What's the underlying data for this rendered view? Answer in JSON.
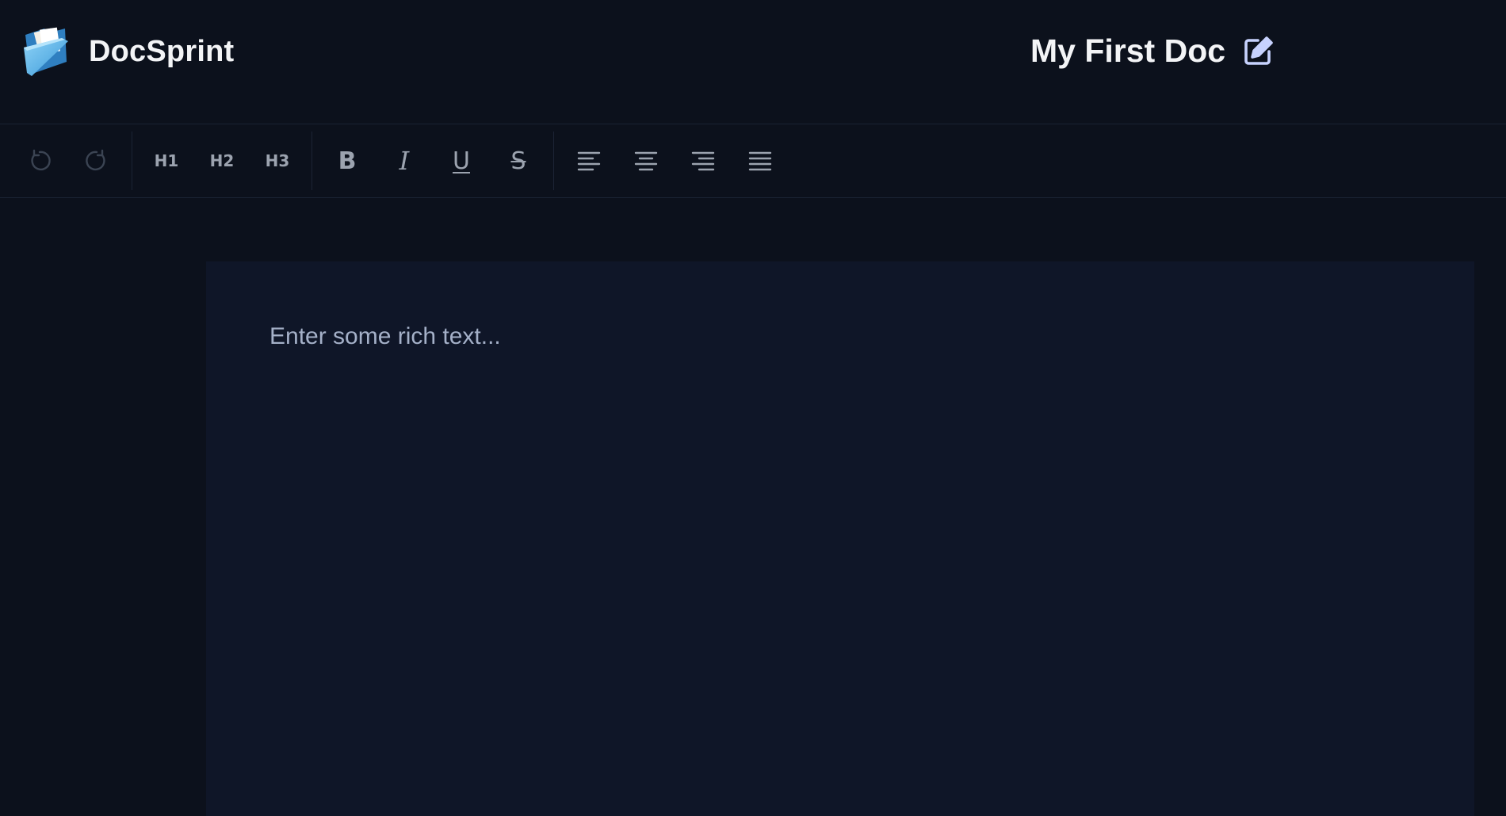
{
  "header": {
    "app_name": "DocSprint",
    "logo_icon": "folder-icon",
    "doc_title": "My First Doc",
    "edit_icon": "edit-icon"
  },
  "toolbar": {
    "history": [
      {
        "name": "undo",
        "icon": "undo-icon",
        "disabled": true
      },
      {
        "name": "redo",
        "icon": "redo-icon",
        "disabled": true
      }
    ],
    "headings": [
      {
        "label": "H1"
      },
      {
        "label": "H2"
      },
      {
        "label": "H3"
      }
    ],
    "formatting": [
      {
        "name": "bold",
        "label": "B"
      },
      {
        "name": "italic",
        "label": "I"
      },
      {
        "name": "underline",
        "label": "U"
      },
      {
        "name": "strikethrough",
        "label": "S"
      }
    ],
    "alignment": [
      {
        "name": "align-left",
        "icon": "align-left-icon"
      },
      {
        "name": "align-center",
        "icon": "align-center-icon"
      },
      {
        "name": "align-right",
        "icon": "align-right-icon"
      },
      {
        "name": "align-justify",
        "icon": "align-justify-icon"
      }
    ]
  },
  "editor": {
    "placeholder": "Enter some rich text..."
  },
  "colors": {
    "background": "#0c111c",
    "editor_background": "#0f1628",
    "text": "#f3f4f6",
    "toolbar_icon": "#9ca3af",
    "toolbar_icon_disabled": "#3b4453",
    "placeholder": "#a4b0c8",
    "edit_icon": "#c7d2fe"
  }
}
